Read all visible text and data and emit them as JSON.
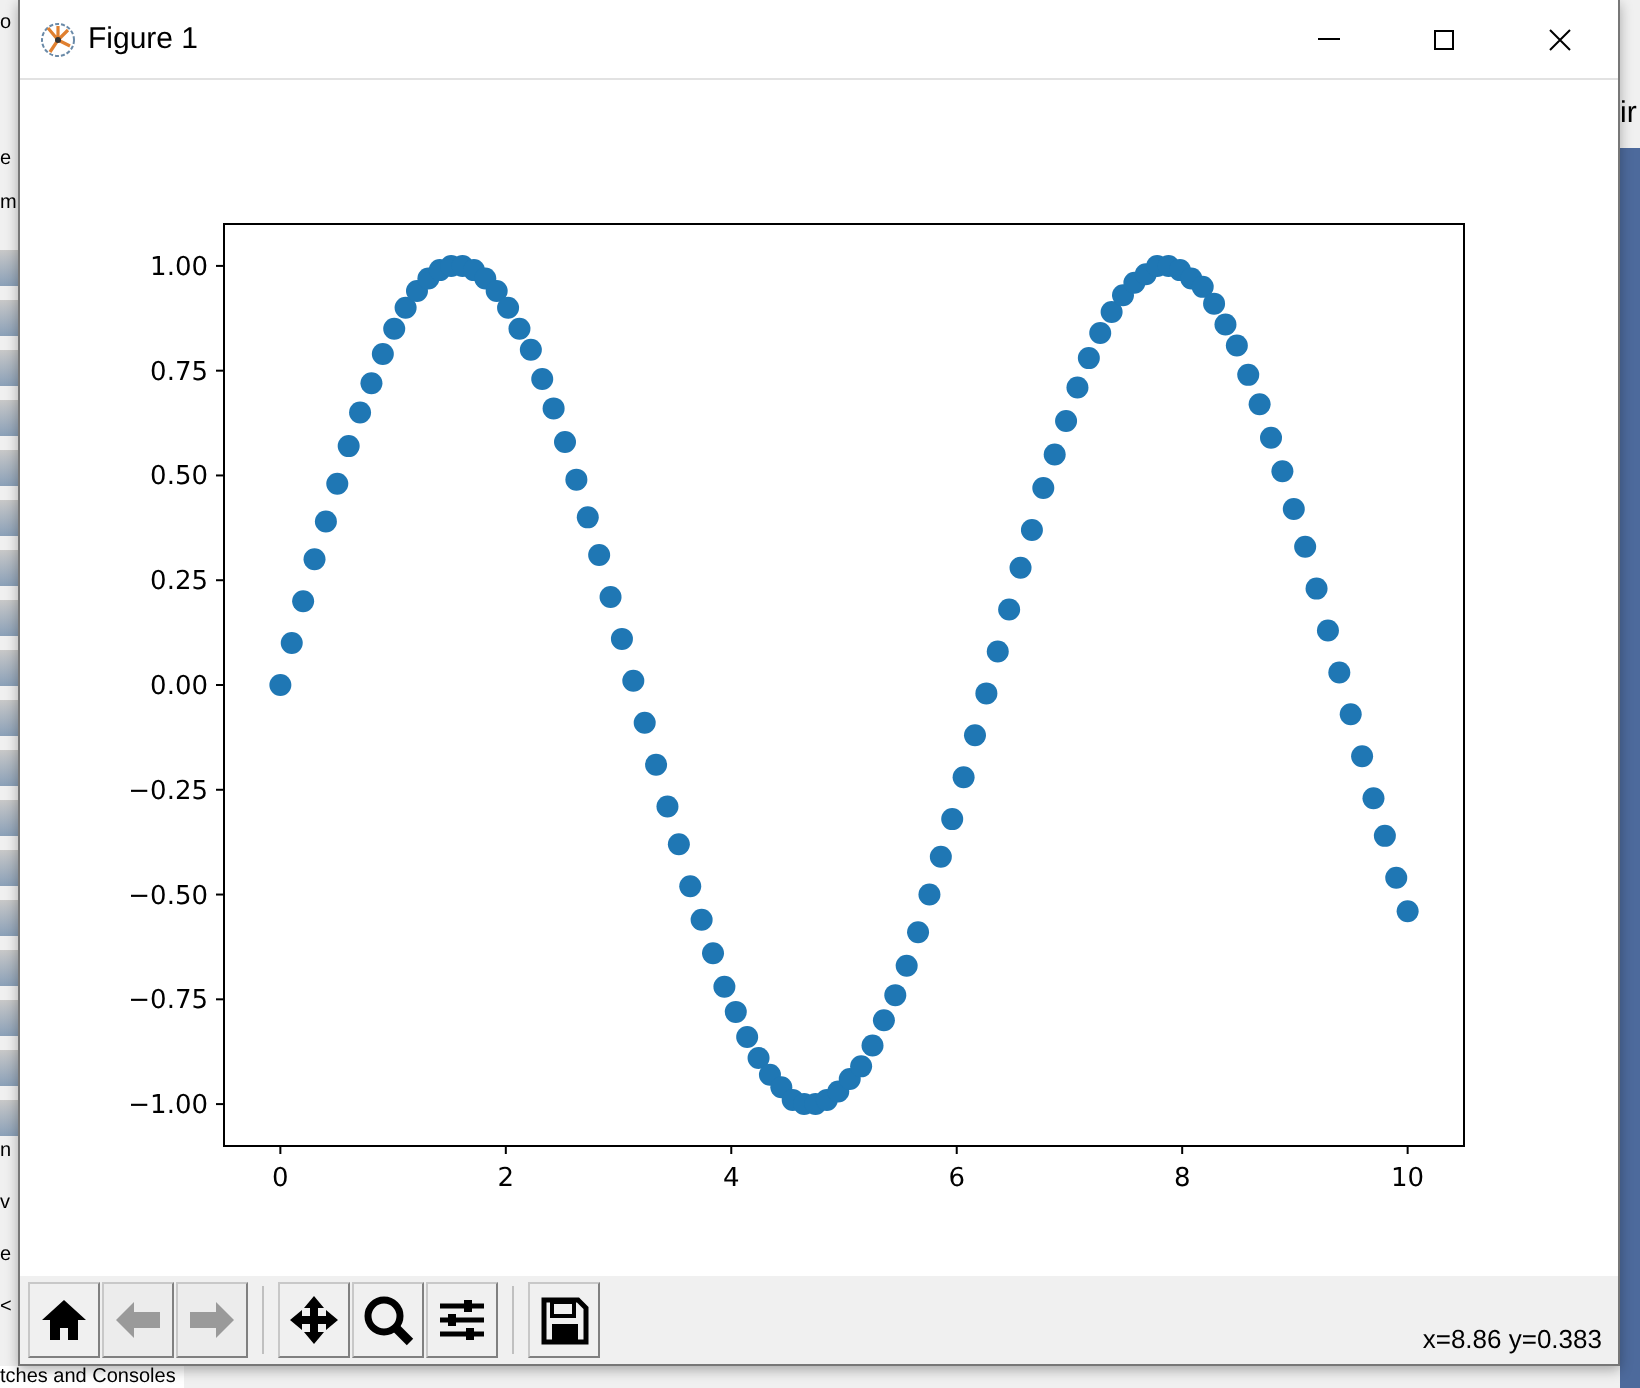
{
  "background": {
    "left_fragments": [
      {
        "text": "o"
      },
      {
        "text": "e"
      },
      {
        "text": "m"
      },
      {
        "text": "n"
      },
      {
        "text": "v"
      },
      {
        "text": "e"
      },
      {
        "text": "<"
      }
    ],
    "bottom_text": "tches and Consoles",
    "right_fragment": "ir"
  },
  "window": {
    "title": "Figure 1"
  },
  "figure": {
    "chart_data": {
      "type": "scatter",
      "xlim": [
        -0.5,
        10.5
      ],
      "ylim": [
        -1.1,
        1.1
      ],
      "xticks": [
        0,
        2,
        4,
        6,
        8,
        10
      ],
      "yticks": [
        {
          "value": -1,
          "label": "−1.00"
        },
        {
          "value": -0.75,
          "label": "−0.75"
        },
        {
          "value": -0.5,
          "label": "−0.50"
        },
        {
          "value": -0.25,
          "label": "−0.25"
        },
        {
          "value": 0,
          "label": "0.00"
        },
        {
          "value": 0.25,
          "label": "0.25"
        },
        {
          "value": 0.5,
          "label": "0.50"
        },
        {
          "value": 0.75,
          "label": "0.75"
        },
        {
          "value": 1,
          "label": "1.00"
        }
      ],
      "x": [
        0,
        0.101,
        0.202,
        0.303,
        0.404,
        0.505,
        0.606,
        0.707,
        0.808,
        0.909,
        1.01,
        1.111,
        1.212,
        1.313,
        1.414,
        1.515,
        1.616,
        1.717,
        1.818,
        1.919,
        2.02,
        2.121,
        2.222,
        2.323,
        2.424,
        2.525,
        2.626,
        2.727,
        2.828,
        2.929,
        3.03,
        3.131,
        3.232,
        3.333,
        3.434,
        3.535,
        3.636,
        3.737,
        3.838,
        3.939,
        4.04,
        4.141,
        4.242,
        4.343,
        4.444,
        4.545,
        4.646,
        4.747,
        4.848,
        4.949,
        5.051,
        5.152,
        5.253,
        5.354,
        5.455,
        5.556,
        5.657,
        5.758,
        5.859,
        5.96,
        6.061,
        6.162,
        6.263,
        6.364,
        6.465,
        6.566,
        6.667,
        6.768,
        6.869,
        6.97,
        7.071,
        7.172,
        7.273,
        7.374,
        7.475,
        7.576,
        7.677,
        7.778,
        7.879,
        7.98,
        8.081,
        8.182,
        8.283,
        8.384,
        8.485,
        8.586,
        8.687,
        8.788,
        8.889,
        8.99,
        9.091,
        9.192,
        9.293,
        9.394,
        9.495,
        9.596,
        9.697,
        9.798,
        9.899,
        10
      ],
      "series": [
        {
          "color": "#1f77b4",
          "values": [
            0,
            0.1,
            0.2,
            0.3,
            0.39,
            0.48,
            0.57,
            0.65,
            0.72,
            0.79,
            0.85,
            0.9,
            0.94,
            0.97,
            0.99,
            1,
            1,
            0.99,
            0.97,
            0.94,
            0.9,
            0.85,
            0.8,
            0.73,
            0.66,
            0.58,
            0.49,
            0.4,
            0.31,
            0.21,
            0.11,
            0.01,
            -0.09,
            -0.19,
            -0.29,
            -0.38,
            -0.48,
            -0.56,
            -0.64,
            -0.72,
            -0.78,
            -0.84,
            -0.89,
            -0.93,
            -0.96,
            -0.99,
            -1,
            -1,
            -0.99,
            -0.97,
            -0.94,
            -0.91,
            -0.86,
            -0.8,
            -0.74,
            -0.67,
            -0.59,
            -0.5,
            -0.41,
            -0.32,
            -0.22,
            -0.12,
            -0.02,
            0.08,
            0.18,
            0.28,
            0.37,
            0.47,
            0.55,
            0.63,
            0.71,
            0.78,
            0.84,
            0.89,
            0.93,
            0.96,
            0.98,
            1,
            1,
            0.99,
            0.97,
            0.95,
            0.91,
            0.86,
            0.81,
            0.74,
            0.67,
            0.59,
            0.51,
            0.42,
            0.33,
            0.23,
            0.13,
            0.03,
            -0.07,
            -0.17,
            -0.27,
            -0.36,
            -0.46,
            -0.54
          ]
        }
      ]
    }
  },
  "toolbar": {
    "groups": [
      [
        {
          "kind": "home",
          "disabled": false
        },
        {
          "kind": "back",
          "disabled": true
        },
        {
          "kind": "forward",
          "disabled": true
        }
      ],
      [
        {
          "kind": "pan",
          "disabled": false
        },
        {
          "kind": "zoom",
          "disabled": false
        },
        {
          "kind": "configure",
          "disabled": false
        }
      ],
      [
        {
          "kind": "save",
          "disabled": false
        }
      ]
    ]
  },
  "status": "x=8.86 y=0.383"
}
